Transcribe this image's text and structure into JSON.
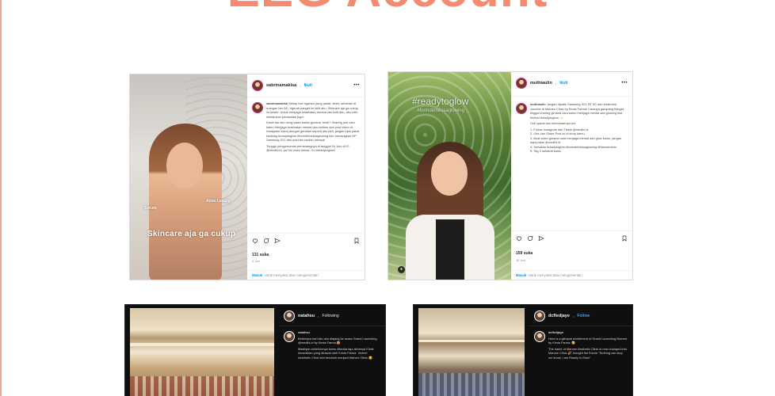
{
  "page": {
    "heading": "EEG Account",
    "accent_color": "#f48a70"
  },
  "posts": [
    {
      "theme": "light",
      "username": "sabrinamakisa",
      "separator": "•",
      "follow": "Ikuti",
      "subtitle": "",
      "overlay": {
        "main": "Skincare aja ga cukup",
        "left": "Serum",
        "right": "Acne Luxury"
      },
      "caption": {
        "author": "sabrinamakisa",
        "paragraphs": [
          "Setiap hari ngantor yang padat, stres, seharian di ruangan ber-AC, ngerah banget ke kulit aku. Skincare aja ga cukup ini bestie. Untuk menjaga kesehatan mental dan kulit aku, aku rutin melakukan perawatan juga~",
          "Kasih tau aku dong kalau kalian gimana, besti? Sharing yuk cara kamu menjaga kesehatan mental dan kulitmu dan post video di Instagram kamu dengan gerakan seperti aku tadi, jangan lupa pakai hashtag #readytoglow #formdirtnessaglowing dan menangkan HP Samsung S21 dan puluhan hadiah lainnya!",
          "Tunggu pengumuman pemenangnya di tanggal 16 Juni di IG @medihi.id. ya! No more stress, I'm #readytoglow!"
        ]
      },
      "likes": "131 suka",
      "date": "6 Juni",
      "login": {
        "link": "Masuk",
        "text": "untuk menyukai atau mengomentari."
      }
    },
    {
      "theme": "light",
      "username": "muthiaulin",
      "separator": "•",
      "follow": "Ikuti",
      "subtitle": "",
      "overlay": {
        "main": "#readytoglow",
        "sub": "#formdirtnessaglowing"
      },
      "caption": {
        "author": "muthiaulin",
        "paragraphs": [
          "Jangan dipatin Samsung S21 FE 5G dan treatment voucher di Marvee Clinic by Kimia Farma! Caranya gampang banget, tinggal sharing gimana cara kamu menjaga mental dan glowing biar terlihat #readytoglow ✨",
          "Cek syarat dan ketentuannya ya!:",
          "1. Follow Instagram dan Tiktok @medihi.id",
          "2. Like dan Share Post ini di story kamu",
          "3. Buat video gimana cara menjaga mental dan glow kamu, jangan lupa pakai @medihi.id",
          "4. Sertakan #readytoglow #formdirtnessaglowing #Marveeclinic",
          "5. Tag 3 sahabat kamu"
        ]
      },
      "likes": "159 suka",
      "date": "16 Juni",
      "login": {
        "link": "Masuk",
        "text": "untuk menyukai atau mengomentari."
      }
    },
    {
      "theme": "dark",
      "username": "natahsu",
      "separator": "•",
      "follow": "Following",
      "subtitle": "",
      "caption": {
        "author": "natahsu",
        "paragraphs": [
          "Beberapa hari lalu aku diajang ke acara Grand Launching @medihi.id by Kimia Farma 😍",
          "Masihjan sebelumnya kamu ditanda tapi akhirnya Klinik kecantikan yang dirawat oleh Kimia Farma. Veneer Aesthetic Clinic kini berubah menjadi Marvee Clinic 😊"
        ]
      }
    },
    {
      "theme": "dark",
      "username": "dcfledjaye",
      "separator": "•",
      "follow": "Follow",
      "subtitle": "",
      "caption": {
        "author": "dcfledjaye",
        "paragraphs": [
          "Here is a glimpse excitement of Grand Launching Marvee by Kimia Farma. 😊",
          "The name of Marvee Aesthetic Clinic is now changed into Marvee Clinic 🎉 brought the theme \"Nothing can stop me know, I am Ready to Glow\""
        ]
      }
    }
  ]
}
